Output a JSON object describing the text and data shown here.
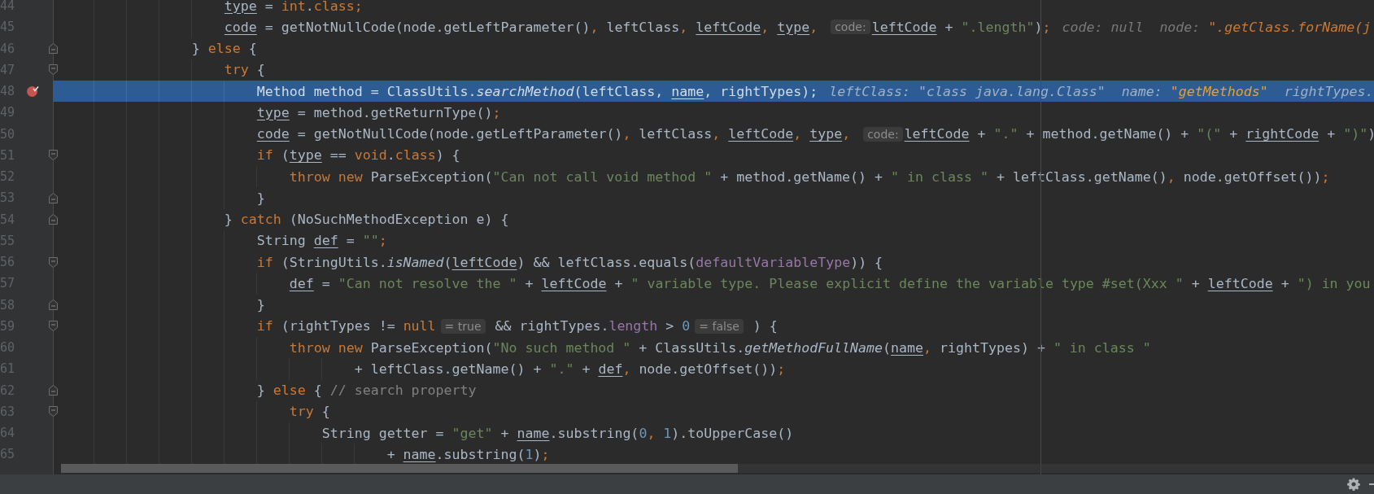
{
  "editor": {
    "lines": [
      {
        "number": "44",
        "breakpoint": false,
        "current": false,
        "segments": [
          {
            "kind": "code",
            "tokens": [
              {
                "text": "                    type",
                "kind": "variable"
              },
              {
                "text": " = ",
                "kind": "plain"
              },
              {
                "text": "int",
                "kind": "keyword"
              },
              {
                "text": ".",
                "kind": "plain"
              },
              {
                "text": "class",
                "kind": "keyword"
              },
              {
                "text": ";",
                "kind": "keyword"
              }
            ]
          }
        ]
      },
      {
        "number": "45",
        "breakpoint": false,
        "current": false,
        "segments": [
          {
            "kind": "code",
            "tokens": [
              {
                "text": "                    code",
                "kind": "variable"
              },
              {
                "text": " = getNotNullCode(node.getLeftParameter()",
                "kind": "plain"
              },
              {
                "text": ", ",
                "kind": "keyword"
              },
              {
                "text": "leftClass",
                "kind": "plain"
              },
              {
                "text": ", ",
                "kind": "keyword"
              },
              {
                "text": "leftCode",
                "kind": "variable"
              },
              {
                "text": ", ",
                "kind": "keyword"
              },
              {
                "text": "type",
                "kind": "variable"
              },
              {
                "text": ", ",
                "kind": "keyword"
              }
            ]
          },
          {
            "kind": "inlay",
            "text": "code:"
          },
          {
            "kind": "code",
            "tokens": [
              {
                "text": "leftCode",
                "kind": "variable"
              },
              {
                "text": " + ",
                "kind": "plain"
              },
              {
                "text": "\".length\"",
                "kind": "string"
              },
              {
                "text": ")",
                "kind": "plain"
              },
              {
                "text": ";",
                "kind": "keyword"
              }
            ]
          },
          {
            "kind": "debug",
            "tokens": [
              {
                "text": "code: null  node: ",
                "kind": "debug-name"
              },
              {
                "text": "\".getClass.forName(j",
                "kind": "debug-value"
              }
            ]
          }
        ]
      },
      {
        "number": "46",
        "fold": {
          "kind": "end"
        },
        "breakpoint": false,
        "current": false,
        "segments": [
          {
            "kind": "code",
            "tokens": [
              {
                "text": "                }",
                "kind": "plain"
              },
              {
                "text": " else ",
                "kind": "keyword"
              },
              {
                "text": "{",
                "kind": "plain"
              }
            ]
          }
        ]
      },
      {
        "number": "47",
        "fold": {
          "kind": "start"
        },
        "breakpoint": false,
        "current": false,
        "segments": [
          {
            "kind": "code",
            "tokens": [
              {
                "text": "                    try ",
                "kind": "keyword"
              },
              {
                "text": "{",
                "kind": "plain"
              }
            ]
          }
        ]
      },
      {
        "number": "48",
        "breakpoint": true,
        "current": true,
        "segments": [
          {
            "kind": "code",
            "tokens": [
              {
                "text": "                        Method method = ClassUtils.",
                "kind": "plain"
              },
              {
                "text": "searchMethod",
                "kind": "method"
              },
              {
                "text": "(leftClass",
                "kind": "plain"
              },
              {
                "text": ", ",
                "kind": "keyword"
              },
              {
                "text": "name",
                "kind": "variable"
              },
              {
                "text": ", ",
                "kind": "keyword"
              },
              {
                "text": "rightTypes)",
                "kind": "plain"
              },
              {
                "text": ";",
                "kind": "keyword"
              }
            ]
          },
          {
            "kind": "debug",
            "tokens": [
              {
                "text": "leftClass: \"class java.lang.Class\"  name: ",
                "kind": "debug-name"
              },
              {
                "text": "\"getMethods\"",
                "kind": "debug-value"
              },
              {
                "text": "  rightTypes.",
                "kind": "debug-name"
              }
            ]
          }
        ]
      },
      {
        "number": "49",
        "breakpoint": false,
        "current": false,
        "segments": [
          {
            "kind": "code",
            "tokens": [
              {
                "text": "                        type",
                "kind": "variable"
              },
              {
                "text": " = method.getReturnType()",
                "kind": "plain"
              },
              {
                "text": ";",
                "kind": "keyword"
              }
            ]
          }
        ]
      },
      {
        "number": "50",
        "breakpoint": false,
        "current": false,
        "segments": [
          {
            "kind": "code",
            "tokens": [
              {
                "text": "                        code",
                "kind": "variable"
              },
              {
                "text": " = getNotNullCode(node.getLeftParameter()",
                "kind": "plain"
              },
              {
                "text": ", ",
                "kind": "keyword"
              },
              {
                "text": "leftClass",
                "kind": "plain"
              },
              {
                "text": ", ",
                "kind": "keyword"
              },
              {
                "text": "leftCode",
                "kind": "variable"
              },
              {
                "text": ", ",
                "kind": "keyword"
              },
              {
                "text": "type",
                "kind": "variable"
              },
              {
                "text": ", ",
                "kind": "keyword"
              }
            ]
          },
          {
            "kind": "inlay",
            "text": "code:"
          },
          {
            "kind": "code",
            "tokens": [
              {
                "text": "leftCode",
                "kind": "variable"
              },
              {
                "text": " + ",
                "kind": "plain"
              },
              {
                "text": "\".\"",
                "kind": "string"
              },
              {
                "text": " + method.getName() + ",
                "kind": "plain"
              },
              {
                "text": "\"(\"",
                "kind": "string"
              },
              {
                "text": " + ",
                "kind": "plain"
              },
              {
                "text": "rightCode",
                "kind": "variable"
              },
              {
                "text": " + ",
                "kind": "plain"
              },
              {
                "text": "\")\"",
                "kind": "string"
              },
              {
                "text": ")",
                "kind": "plain"
              }
            ]
          }
        ]
      },
      {
        "number": "51",
        "fold": {
          "kind": "start"
        },
        "breakpoint": false,
        "current": false,
        "segments": [
          {
            "kind": "code",
            "tokens": [
              {
                "text": "                        if ",
                "kind": "keyword"
              },
              {
                "text": "(",
                "kind": "plain"
              },
              {
                "text": "type",
                "kind": "variable"
              },
              {
                "text": " == ",
                "kind": "plain"
              },
              {
                "text": "void",
                "kind": "keyword"
              },
              {
                "text": ".",
                "kind": "plain"
              },
              {
                "text": "class",
                "kind": "keyword"
              },
              {
                "text": ") {",
                "kind": "plain"
              }
            ]
          }
        ]
      },
      {
        "number": "52",
        "breakpoint": false,
        "current": false,
        "segments": [
          {
            "kind": "code",
            "tokens": [
              {
                "text": "                            throw new ",
                "kind": "keyword"
              },
              {
                "text": "ParseException(",
                "kind": "plain"
              },
              {
                "text": "\"Can not call void method \"",
                "kind": "string"
              },
              {
                "text": " + method.getName() + ",
                "kind": "plain"
              },
              {
                "text": "\" in class \"",
                "kind": "string"
              },
              {
                "text": " + leftClass.getName()",
                "kind": "plain"
              },
              {
                "text": ", ",
                "kind": "keyword"
              },
              {
                "text": "node.getOffset())",
                "kind": "plain"
              },
              {
                "text": ";",
                "kind": "keyword"
              }
            ]
          }
        ]
      },
      {
        "number": "53",
        "fold": {
          "kind": "end"
        },
        "breakpoint": false,
        "current": false,
        "segments": [
          {
            "kind": "code",
            "tokens": [
              {
                "text": "                        }",
                "kind": "plain"
              }
            ]
          }
        ]
      },
      {
        "number": "54",
        "fold": {
          "kind": "end"
        },
        "breakpoint": false,
        "current": false,
        "segments": [
          {
            "kind": "code",
            "tokens": [
              {
                "text": "                    } ",
                "kind": "plain"
              },
              {
                "text": "catch ",
                "kind": "keyword"
              },
              {
                "text": "(NoSuchMethodException e) {",
                "kind": "plain"
              }
            ]
          }
        ]
      },
      {
        "number": "55",
        "breakpoint": false,
        "current": false,
        "segments": [
          {
            "kind": "code",
            "tokens": [
              {
                "text": "                        String ",
                "kind": "plain"
              },
              {
                "text": "def",
                "kind": "variable"
              },
              {
                "text": " = ",
                "kind": "plain"
              },
              {
                "text": "\"\"",
                "kind": "string"
              },
              {
                "text": ";",
                "kind": "keyword"
              }
            ]
          }
        ]
      },
      {
        "number": "56",
        "fold": {
          "kind": "start"
        },
        "breakpoint": false,
        "current": false,
        "segments": [
          {
            "kind": "code",
            "tokens": [
              {
                "text": "                        if ",
                "kind": "keyword"
              },
              {
                "text": "(StringUtils.",
                "kind": "plain"
              },
              {
                "text": "isNamed",
                "kind": "method"
              },
              {
                "text": "(",
                "kind": "plain"
              },
              {
                "text": "leftCode",
                "kind": "variable"
              },
              {
                "text": ") && leftClass.equals(",
                "kind": "plain"
              },
              {
                "text": "defaultVariableType",
                "kind": "field"
              },
              {
                "text": ")) {",
                "kind": "plain"
              }
            ]
          }
        ]
      },
      {
        "number": "57",
        "breakpoint": false,
        "current": false,
        "segments": [
          {
            "kind": "code",
            "tokens": [
              {
                "text": "                            def",
                "kind": "variable"
              },
              {
                "text": " = ",
                "kind": "plain"
              },
              {
                "text": "\"Can not resolve the \"",
                "kind": "string"
              },
              {
                "text": " + ",
                "kind": "plain"
              },
              {
                "text": "leftCode",
                "kind": "variable"
              },
              {
                "text": " + ",
                "kind": "plain"
              },
              {
                "text": "\" variable type. Please explicit define the variable type #set(Xxx \"",
                "kind": "string"
              },
              {
                "text": " + ",
                "kind": "plain"
              },
              {
                "text": "leftCode",
                "kind": "variable"
              },
              {
                "text": " + ",
                "kind": "plain"
              },
              {
                "text": "\") in you",
                "kind": "string"
              }
            ]
          }
        ]
      },
      {
        "number": "58",
        "fold": {
          "kind": "end"
        },
        "breakpoint": false,
        "current": false,
        "segments": [
          {
            "kind": "code",
            "tokens": [
              {
                "text": "                        }",
                "kind": "plain"
              }
            ]
          }
        ]
      },
      {
        "number": "59",
        "fold": {
          "kind": "start"
        },
        "breakpoint": false,
        "current": false,
        "segments": [
          {
            "kind": "code",
            "tokens": [
              {
                "text": "                        if ",
                "kind": "keyword"
              },
              {
                "text": "(rightTypes != ",
                "kind": "plain"
              },
              {
                "text": "null",
                "kind": "keyword"
              }
            ]
          },
          {
            "kind": "inlay",
            "text": "= true"
          },
          {
            "kind": "code",
            "tokens": [
              {
                "text": " && rightTypes.",
                "kind": "plain"
              },
              {
                "text": "length",
                "kind": "field"
              },
              {
                "text": " > ",
                "kind": "plain"
              },
              {
                "text": "0",
                "kind": "number"
              }
            ]
          },
          {
            "kind": "inlay",
            "text": "= false"
          },
          {
            "kind": "code",
            "tokens": [
              {
                "text": " ) {",
                "kind": "plain"
              }
            ]
          }
        ]
      },
      {
        "number": "60",
        "breakpoint": false,
        "current": false,
        "segments": [
          {
            "kind": "code",
            "tokens": [
              {
                "text": "                            throw new ",
                "kind": "keyword"
              },
              {
                "text": "ParseException(",
                "kind": "plain"
              },
              {
                "text": "\"No such method \"",
                "kind": "string"
              },
              {
                "text": " + ClassUtils.",
                "kind": "plain"
              },
              {
                "text": "getMethodFullName",
                "kind": "method"
              },
              {
                "text": "(",
                "kind": "plain"
              },
              {
                "text": "name",
                "kind": "variable"
              },
              {
                "text": ", ",
                "kind": "keyword"
              },
              {
                "text": "rightTypes) + ",
                "kind": "plain"
              },
              {
                "text": "\" in class \"",
                "kind": "string"
              }
            ]
          }
        ]
      },
      {
        "number": "61",
        "breakpoint": false,
        "current": false,
        "segments": [
          {
            "kind": "code",
            "tokens": [
              {
                "text": "                                    + leftClass.getName() + ",
                "kind": "plain"
              },
              {
                "text": "\".\"",
                "kind": "string"
              },
              {
                "text": " + ",
                "kind": "plain"
              },
              {
                "text": "def",
                "kind": "variable"
              },
              {
                "text": ", ",
                "kind": "keyword"
              },
              {
                "text": "node.getOffset())",
                "kind": "plain"
              },
              {
                "text": ";",
                "kind": "keyword"
              }
            ]
          }
        ]
      },
      {
        "number": "62",
        "fold": {
          "kind": "end"
        },
        "breakpoint": false,
        "current": false,
        "segments": [
          {
            "kind": "code",
            "tokens": [
              {
                "text": "                        } ",
                "kind": "plain"
              },
              {
                "text": "else ",
                "kind": "keyword"
              },
              {
                "text": "{ ",
                "kind": "plain"
              },
              {
                "text": "// search property",
                "kind": "comment"
              }
            ]
          }
        ]
      },
      {
        "number": "63",
        "fold": {
          "kind": "start"
        },
        "breakpoint": false,
        "current": false,
        "segments": [
          {
            "kind": "code",
            "tokens": [
              {
                "text": "                            try ",
                "kind": "keyword"
              },
              {
                "text": "{",
                "kind": "plain"
              }
            ]
          }
        ]
      },
      {
        "number": "64",
        "breakpoint": false,
        "current": false,
        "segments": [
          {
            "kind": "code",
            "tokens": [
              {
                "text": "                                String getter = ",
                "kind": "plain"
              },
              {
                "text": "\"get\"",
                "kind": "string"
              },
              {
                "text": " + ",
                "kind": "plain"
              },
              {
                "text": "name",
                "kind": "variable"
              },
              {
                "text": ".substring(",
                "kind": "plain"
              },
              {
                "text": "0",
                "kind": "number"
              },
              {
                "text": ", ",
                "kind": "keyword"
              },
              {
                "text": "1",
                "kind": "number"
              },
              {
                "text": ").toUpperCase()",
                "kind": "plain"
              }
            ]
          }
        ]
      },
      {
        "number": "65",
        "breakpoint": false,
        "current": false,
        "segments": [
          {
            "kind": "code",
            "tokens": [
              {
                "text": "                                        + ",
                "kind": "plain"
              },
              {
                "text": "name",
                "kind": "variable"
              },
              {
                "text": ".substring(",
                "kind": "plain"
              },
              {
                "text": "1",
                "kind": "number"
              },
              {
                "text": ")",
                "kind": "plain"
              },
              {
                "text": ";",
                "kind": "keyword"
              }
            ]
          }
        ]
      }
    ]
  }
}
